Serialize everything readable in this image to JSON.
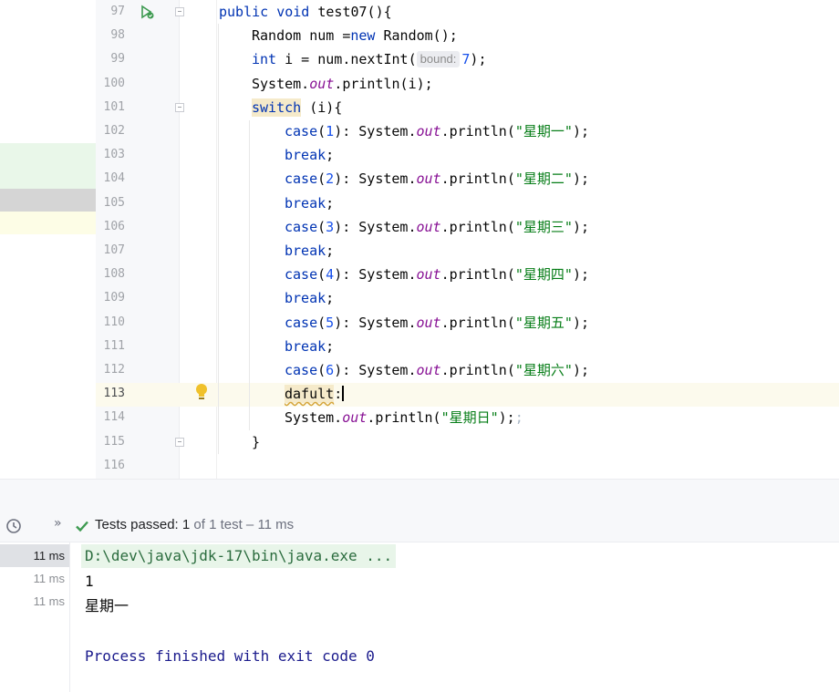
{
  "editor": {
    "lines": [
      {
        "n": "97",
        "tokens": [
          [
            "kw",
            "public "
          ],
          [
            "kw",
            "void "
          ],
          [
            "",
            "test07(){"
          ]
        ],
        "indent": 0
      },
      {
        "n": "98",
        "tokens": [
          [
            "",
            "Random num ="
          ],
          [
            "kw",
            "new "
          ],
          [
            "",
            "Random();"
          ]
        ],
        "indent": 1
      },
      {
        "n": "99",
        "tokens": [
          [
            "kw",
            "int "
          ],
          [
            "",
            "i = num.nextInt("
          ],
          [
            "hint",
            "bound:"
          ],
          [
            "num",
            "7"
          ],
          [
            "",
            ");"
          ]
        ],
        "indent": 1
      },
      {
        "n": "100",
        "tokens": [
          [
            "",
            "System."
          ],
          [
            "fld",
            "out"
          ],
          [
            "",
            ".println(i);"
          ]
        ],
        "indent": 1
      },
      {
        "n": "101",
        "tokens": [
          [
            "kwhl",
            "switch"
          ],
          [
            "",
            " (i){"
          ]
        ],
        "indent": 1
      },
      {
        "n": "102",
        "tokens": [
          [
            "kw",
            "case"
          ],
          [
            "",
            "("
          ],
          [
            "num",
            "1"
          ],
          [
            "",
            "): System."
          ],
          [
            "fld",
            "out"
          ],
          [
            "",
            ".println("
          ],
          [
            "str",
            "\"星期一\""
          ],
          [
            "",
            ");"
          ]
        ],
        "indent": 2
      },
      {
        "n": "103",
        "tokens": [
          [
            "kw",
            "break"
          ],
          [
            "",
            ";"
          ]
        ],
        "indent": 2
      },
      {
        "n": "104",
        "tokens": [
          [
            "kw",
            "case"
          ],
          [
            "",
            "("
          ],
          [
            "num",
            "2"
          ],
          [
            "",
            "): System."
          ],
          [
            "fld",
            "out"
          ],
          [
            "",
            ".println("
          ],
          [
            "str",
            "\"星期二\""
          ],
          [
            "",
            ");"
          ]
        ],
        "indent": 2
      },
      {
        "n": "105",
        "tokens": [
          [
            "kw",
            "break"
          ],
          [
            "",
            ";"
          ]
        ],
        "indent": 2
      },
      {
        "n": "106",
        "tokens": [
          [
            "kw",
            "case"
          ],
          [
            "",
            "("
          ],
          [
            "num",
            "3"
          ],
          [
            "",
            "): System."
          ],
          [
            "fld",
            "out"
          ],
          [
            "",
            ".println("
          ],
          [
            "str",
            "\"星期三\""
          ],
          [
            "",
            ");"
          ]
        ],
        "indent": 2
      },
      {
        "n": "107",
        "tokens": [
          [
            "kw",
            "break"
          ],
          [
            "",
            ";"
          ]
        ],
        "indent": 2
      },
      {
        "n": "108",
        "tokens": [
          [
            "kw",
            "case"
          ],
          [
            "",
            "("
          ],
          [
            "num",
            "4"
          ],
          [
            "",
            "): System."
          ],
          [
            "fld",
            "out"
          ],
          [
            "",
            ".println("
          ],
          [
            "str",
            "\"星期四\""
          ],
          [
            "",
            ");"
          ]
        ],
        "indent": 2
      },
      {
        "n": "109",
        "tokens": [
          [
            "kw",
            "break"
          ],
          [
            "",
            ";"
          ]
        ],
        "indent": 2
      },
      {
        "n": "110",
        "tokens": [
          [
            "kw",
            "case"
          ],
          [
            "",
            "("
          ],
          [
            "num",
            "5"
          ],
          [
            "",
            "): System."
          ],
          [
            "fld",
            "out"
          ],
          [
            "",
            ".println("
          ],
          [
            "str",
            "\"星期五\""
          ],
          [
            "",
            ");"
          ]
        ],
        "indent": 2
      },
      {
        "n": "111",
        "tokens": [
          [
            "kw",
            "break"
          ],
          [
            "",
            ";"
          ]
        ],
        "indent": 2
      },
      {
        "n": "112",
        "tokens": [
          [
            "kw",
            "case"
          ],
          [
            "",
            "("
          ],
          [
            "num",
            "6"
          ],
          [
            "",
            "): System."
          ],
          [
            "fld",
            "out"
          ],
          [
            "",
            ".println("
          ],
          [
            "str",
            "\"星期六\""
          ],
          [
            "",
            ");"
          ]
        ],
        "indent": 2
      },
      {
        "n": "113",
        "tokens": [
          [
            "errhl",
            "dafult"
          ],
          [
            "",
            ":"
          ],
          [
            "caret",
            ""
          ]
        ],
        "indent": 2,
        "current": true
      },
      {
        "n": "114",
        "tokens": [
          [
            "",
            "System."
          ],
          [
            "fld",
            "out"
          ],
          [
            "",
            ".println("
          ],
          [
            "str",
            "\"星期日\""
          ],
          [
            "",
            ");"
          ],
          [
            "grey",
            ";"
          ]
        ],
        "indent": 2
      },
      {
        "n": "115",
        "tokens": [
          [
            "",
            "}"
          ]
        ],
        "indent": 1
      },
      {
        "n": "116",
        "tokens": [],
        "indent": 0
      }
    ]
  },
  "test_results": {
    "status_label": "Tests passed: ",
    "passed": "1",
    "of_text": " of 1 test – 11 ms",
    "tree_rows": [
      "11 ms",
      "11 ms",
      "11 ms"
    ]
  },
  "console": {
    "command": "D:\\dev\\java\\jdk-17\\bin\\java.exe ...",
    "output_1": "1",
    "output_2": "星期一",
    "finish": "Process finished with exit code 0"
  },
  "colors": {
    "vcs_added": "#e6f7e6",
    "vcs_modified": "#d0d0d0",
    "vcs_yellow": "#fdfde8",
    "keyword": "#0033b3",
    "string": "#067d17",
    "field": "#871094"
  },
  "icons": {
    "run": "run-test-icon",
    "bulb": "intention-bulb-icon",
    "clock": "history-clock-icon",
    "check": "check-icon"
  }
}
